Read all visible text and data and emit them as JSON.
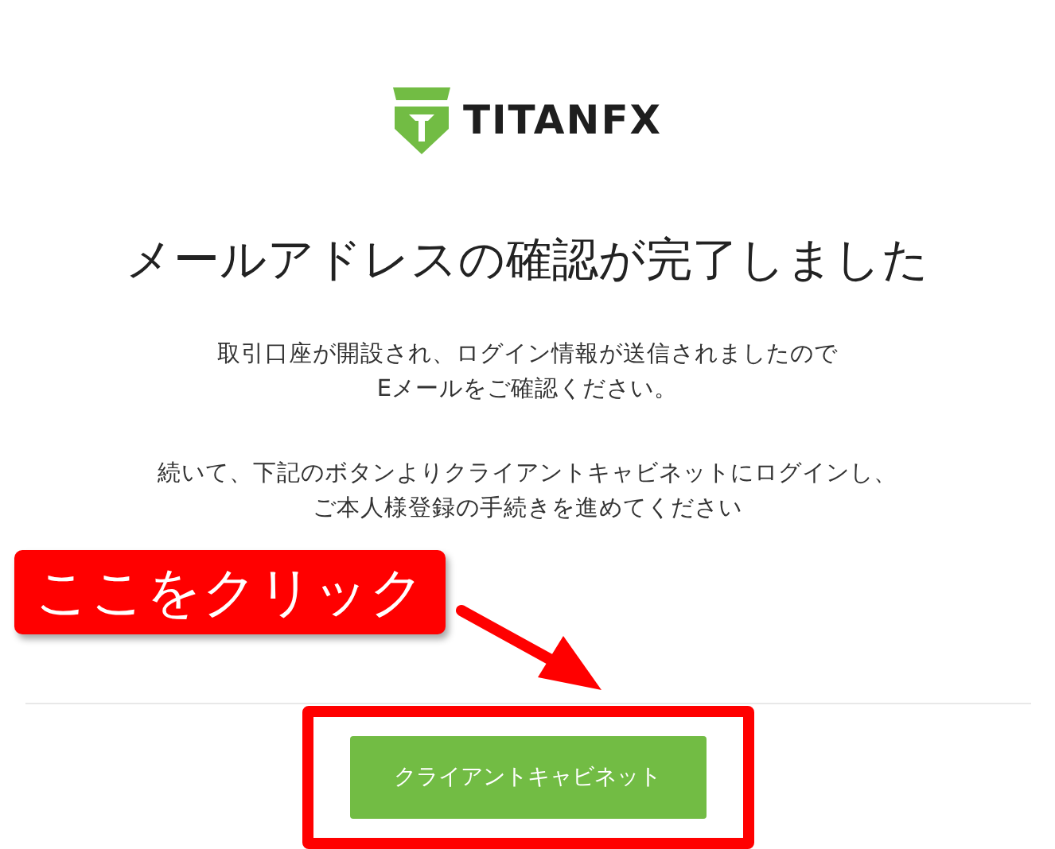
{
  "logo": {
    "text": "TITANFX"
  },
  "heading": "メールアドレスの確認が完了しました",
  "paragraphs": [
    {
      "lines": [
        "取引口座が開設され、ログイン情報が送信されましたので",
        "Eメールをご確認ください。"
      ]
    },
    {
      "lines": [
        "続いて、下記のボタンよりクライアントキャビネットにログインし、",
        "ご本人様登録の手続きを進めてください"
      ]
    }
  ],
  "annotation": {
    "callout": "ここをクリック"
  },
  "button": {
    "label": "クライアントキャビネット"
  }
}
